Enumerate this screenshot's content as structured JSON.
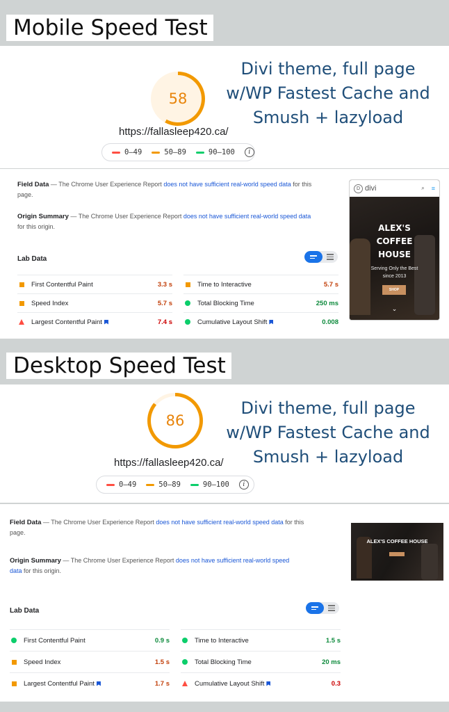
{
  "mobile": {
    "section_label": "Mobile Speed Test",
    "score": "58",
    "score_fraction": 0.58,
    "url": "https://fallasleep420.ca/",
    "legend": [
      "0–49",
      "50–89",
      "90–100"
    ],
    "caption": [
      "Divi theme, full page",
      "w/WP Fastest Cache and",
      "Smush + lazyload"
    ],
    "field_data": {
      "title": "Field Data",
      "text_before": " — The Chrome User Experience Report ",
      "link": "does not have sufficient real-world speed data",
      "text_after": " for this page."
    },
    "origin_summary": {
      "title": "Origin Summary",
      "text_before": " — The Chrome User Experience Report ",
      "link": "does not have sufficient real-world speed data",
      "text_after": " for this origin."
    },
    "lab_title": "Lab Data",
    "metrics": [
      {
        "name": "First Contentful Paint",
        "value": "3.3 s",
        "status": "average"
      },
      {
        "name": "Time to Interactive",
        "value": "5.7 s",
        "status": "average"
      },
      {
        "name": "Speed Index",
        "value": "5.7 s",
        "status": "average"
      },
      {
        "name": "Total Blocking Time",
        "value": "250 ms",
        "status": "pass"
      },
      {
        "name": "Largest Contentful Paint",
        "value": "7.4 s",
        "status": "fail"
      },
      {
        "name": "Cumulative Layout Shift",
        "value": "0.008",
        "status": "pass"
      }
    ],
    "thumbnail": {
      "logo": "divi",
      "heading": [
        "ALEX'S",
        "COFFEE",
        "HOUSE"
      ],
      "tagline": "Serving Only the Best",
      "since": "since 2013",
      "button": "SHOP"
    }
  },
  "desktop": {
    "section_label": "Desktop Speed Test",
    "score": "86",
    "score_fraction": 0.86,
    "url": "https://fallasleep420.ca/",
    "legend": [
      "0–49",
      "50–89",
      "90–100"
    ],
    "caption": [
      "Divi theme, full page",
      "w/WP Fastest Cache and",
      "Smush + lazyload"
    ],
    "field_data": {
      "title": "Field Data",
      "text_before": " — The Chrome User Experience Report ",
      "link": "does not have sufficient real-world speed data",
      "text_after": " for this page."
    },
    "origin_summary": {
      "title": "Origin Summary",
      "text_before": " — The Chrome User Experience Report ",
      "link": "does not have sufficient real-world speed",
      "link2": "data",
      "text_after": " for this origin."
    },
    "lab_title": "Lab Data",
    "metrics": [
      {
        "name": "First Contentful Paint",
        "value": "0.9 s",
        "status": "pass"
      },
      {
        "name": "Time to Interactive",
        "value": "1.5 s",
        "status": "pass"
      },
      {
        "name": "Speed Index",
        "value": "1.5 s",
        "status": "average"
      },
      {
        "name": "Total Blocking Time",
        "value": "20 ms",
        "status": "pass"
      },
      {
        "name": "Largest Contentful Paint",
        "value": "1.7 s",
        "status": "average"
      },
      {
        "name": "Cumulative Layout Shift",
        "value": "0.3",
        "status": "fail"
      }
    ],
    "thumbnail": {
      "heading": "ALEX'S COFFEE HOUSE"
    }
  },
  "colors": {
    "fail": "#ff4e42",
    "average": "#f29900",
    "pass": "#0cce6b",
    "caption": "#1f4e79",
    "link": "#1a57d6"
  }
}
